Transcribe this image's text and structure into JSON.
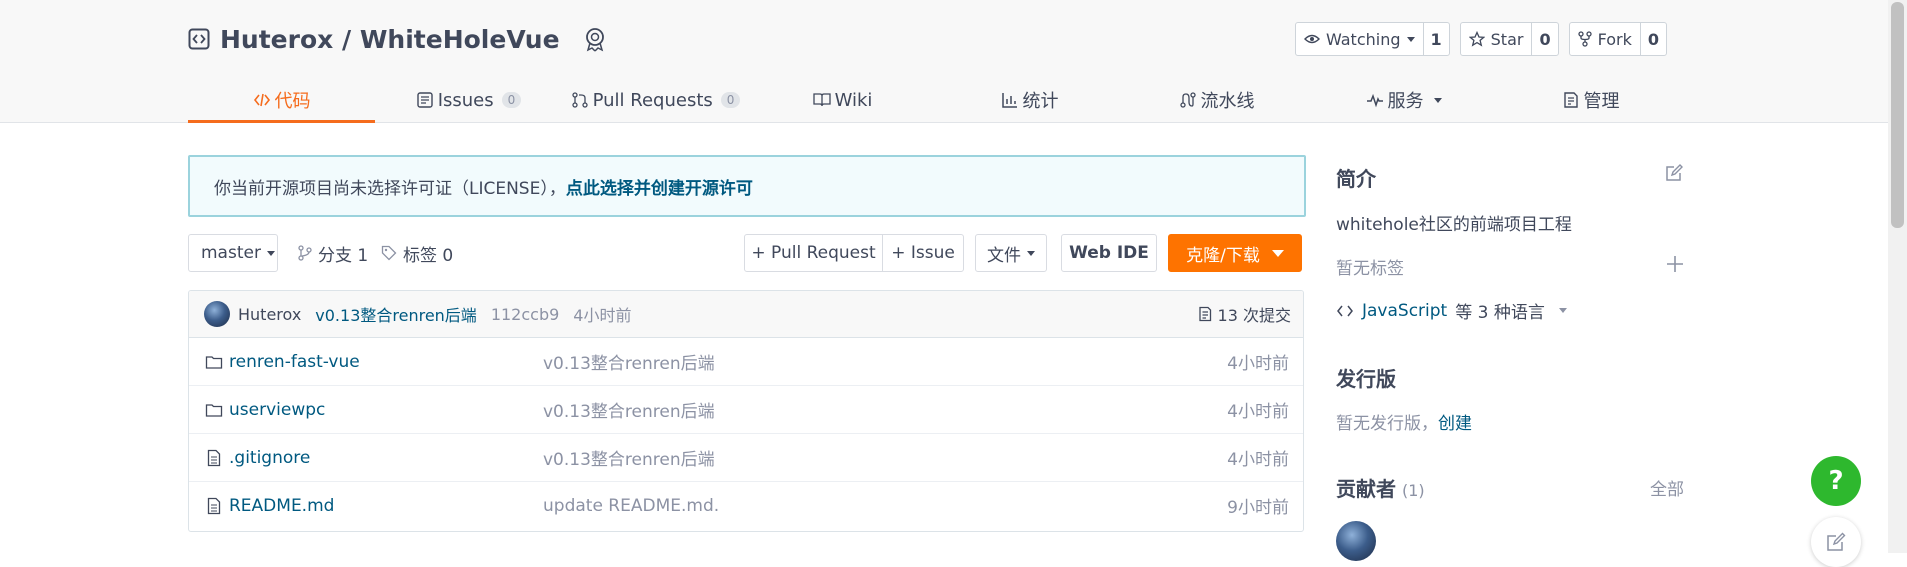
{
  "repo": {
    "owner": "Huterox",
    "separator": "/",
    "name": "WhiteHoleVue"
  },
  "actions": {
    "watch": {
      "label": "Watching",
      "count": "1"
    },
    "star": {
      "label": "Star",
      "count": "0"
    },
    "fork": {
      "label": "Fork",
      "count": "0"
    }
  },
  "tabs": [
    {
      "label": "代码",
      "icon": "code-icon",
      "active": true
    },
    {
      "label": "Issues",
      "badge": "0",
      "icon": "issues-icon"
    },
    {
      "label": "Pull Requests",
      "badge": "0",
      "icon": "pull-request-icon"
    },
    {
      "label": "Wiki",
      "icon": "wiki-icon"
    },
    {
      "label": "统计",
      "icon": "chart-icon"
    },
    {
      "label": "流水线",
      "icon": "pipeline-icon"
    },
    {
      "label": "服务",
      "icon": "pulse-icon"
    },
    {
      "label": "管理",
      "icon": "settings-doc-icon"
    }
  ],
  "license_notice": {
    "text": "你当前开源项目尚未选择许可证（LICENSE），",
    "link": "点此选择并创建开源许可"
  },
  "toolbar": {
    "branch": "master",
    "branches": "分支 1",
    "tags": "标签 0",
    "pull_request": "+ Pull Request",
    "issue": "+ Issue",
    "file": "文件",
    "web_ide": "Web IDE",
    "clone": "克隆/下载"
  },
  "commit": {
    "author": "Huterox",
    "message": "v0.13整合renren后端",
    "hash": "112ccb9",
    "time": "4小时前",
    "count": "13 次提交"
  },
  "files": [
    {
      "name": "renren-fast-vue",
      "type": "folder",
      "message": "v0.13整合renren后端",
      "time": "4小时前"
    },
    {
      "name": "userviewpc",
      "type": "folder",
      "message": "v0.13整合renren后端",
      "time": "4小时前"
    },
    {
      "name": ".gitignore",
      "type": "file",
      "message": "v0.13整合renren后端",
      "time": "4小时前"
    },
    {
      "name": "README.md",
      "type": "file",
      "message": "update README.md.",
      "time": "9小时前"
    }
  ],
  "sidebar": {
    "intro_title": "简介",
    "description": "whitehole社区的前端项目工程",
    "no_tags": "暂无标签",
    "language": "JavaScript",
    "language_more": "等 3 种语言",
    "release_title": "发行版",
    "no_release": "暂无发行版，",
    "create": "创建",
    "contributors_title": "贡献者",
    "contributors_count": "(1)",
    "all": "全部"
  },
  "help": "?",
  "colors": {
    "accent": "#f56c1d",
    "clone_button": "#fe7300",
    "link": "#005980",
    "help_button": "#2eb82e"
  }
}
